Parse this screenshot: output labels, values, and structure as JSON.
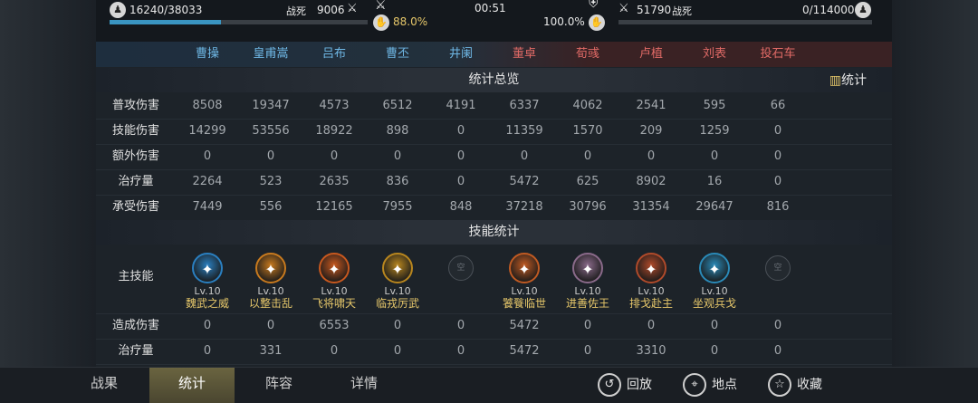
{
  "top": {
    "left_count": "16240/38033",
    "left_dead_label": "战死",
    "left_dead_value": "9006",
    "left_morale": "88.0%",
    "timer": "00:51",
    "right_morale": "100.0%",
    "right_count": "51790",
    "right_dead_label": "战死",
    "right_dead_value": "0/114000",
    "left_hp_fraction": 0.43,
    "right_hp_fraction": 0.0,
    "left_color": "#3a95c2",
    "right_color": "#b64b4b"
  },
  "header": {
    "names": [
      "曹操",
      "皇甫嵩",
      "吕布",
      "曹丕",
      "井阑",
      "董卓",
      "荀彧",
      "卢植",
      "刘表",
      "投石车"
    ],
    "blue": "#6fb8e6",
    "red": "#e06a66"
  },
  "sections": {
    "overview": "统计总览",
    "skills": "技能统计",
    "stats_button": "统计"
  },
  "overview_rows": [
    {
      "label": "普攻伤害",
      "values": [
        "8508",
        "19347",
        "4573",
        "6512",
        "4191",
        "6337",
        "4062",
        "2541",
        "595",
        "66"
      ]
    },
    {
      "label": "技能伤害",
      "values": [
        "14299",
        "53556",
        "18922",
        "898",
        "0",
        "11359",
        "1570",
        "209",
        "1259",
        "0"
      ]
    },
    {
      "label": "额外伤害",
      "values": [
        "0",
        "0",
        "0",
        "0",
        "0",
        "0",
        "0",
        "0",
        "0",
        "0"
      ]
    },
    {
      "label": "治疗量",
      "values": [
        "2264",
        "523",
        "2635",
        "836",
        "0",
        "5472",
        "625",
        "8902",
        "16",
        "0"
      ]
    },
    {
      "label": "承受伤害",
      "values": [
        "7449",
        "556",
        "12165",
        "7955",
        "848",
        "37218",
        "30796",
        "31354",
        "29647",
        "816"
      ]
    }
  ],
  "skills": {
    "row_label": "主技能",
    "empty_text": "空",
    "items": [
      {
        "lv": "Lv.10",
        "name": "魏武之威",
        "icon": "wei-wu-icon",
        "color": "#2a7fc0"
      },
      {
        "lv": "Lv.10",
        "name": "以整击乱",
        "icon": "spear-burst-icon",
        "color": "#c87a1e"
      },
      {
        "lv": "Lv.10",
        "name": "飞将啸天",
        "icon": "flying-general-icon",
        "color": "#c8581e"
      },
      {
        "lv": "Lv.10",
        "name": "临戎厉武",
        "icon": "warrior-icon",
        "color": "#b8861e"
      },
      null,
      {
        "lv": "Lv.10",
        "name": "饕餮临世",
        "icon": "taotie-icon",
        "color": "#c05a22"
      },
      {
        "lv": "Lv.10",
        "name": "进善佐王",
        "icon": "scroll-icon",
        "color": "#8a6a8a"
      },
      {
        "lv": "Lv.10",
        "name": "排戈赴主",
        "icon": "crossed-spears-icon",
        "color": "#b04a2a"
      },
      {
        "lv": "Lv.10",
        "name": "坐观兵戈",
        "icon": "strategist-icon",
        "color": "#2a8ab8"
      },
      null
    ]
  },
  "skill_rows": [
    {
      "label": "造成伤害",
      "values": [
        "0",
        "0",
        "6553",
        "0",
        "0",
        "5472",
        "0",
        "0",
        "0",
        "0"
      ]
    },
    {
      "label": "治疗量",
      "values": [
        "0",
        "331",
        "0",
        "0",
        "0",
        "5472",
        "0",
        "3310",
        "0",
        "0"
      ]
    }
  ],
  "bottom": {
    "tabs": [
      "战果",
      "统计",
      "阵容",
      "详情"
    ],
    "active": 1,
    "actions": [
      {
        "label": "回放",
        "icon": "replay-icon"
      },
      {
        "label": "地点",
        "icon": "location-icon"
      },
      {
        "label": "收藏",
        "icon": "star-icon"
      }
    ]
  }
}
